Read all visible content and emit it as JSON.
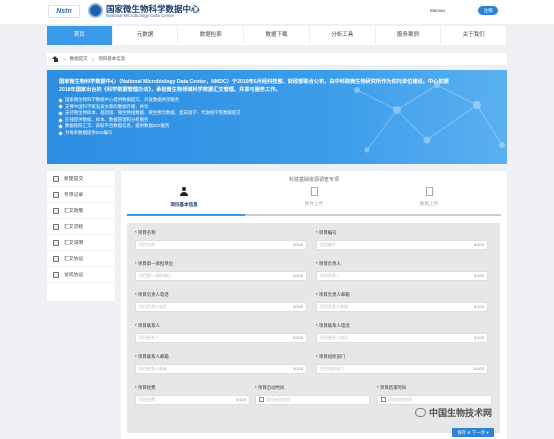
{
  "header": {
    "logo_text": "Nstn",
    "site_title": "国家微生物科学数据中心",
    "site_subtitle": "National Microbiology Data Center",
    "username": "Mamao",
    "logout_label": "注销"
  },
  "nav": {
    "items": [
      {
        "label": "首页",
        "active": true
      },
      {
        "label": "元数据",
        "active": false
      },
      {
        "label": "数据检索",
        "active": false
      },
      {
        "label": "数据下载",
        "active": false
      },
      {
        "label": "分析工具",
        "active": false
      },
      {
        "label": "服务案例",
        "active": false
      },
      {
        "label": "关于我们",
        "active": false
      }
    ]
  },
  "breadcrumb": [
    "数据提交",
    "项目基本信息"
  ],
  "banner": {
    "paragraph": "国家微生物科学数据中心（National Microbiology Data Center，NMDC）于2019年6月经科技部、财政部联合公布，由中科院微生物研究所作为依托单位建设。中心依据2018年国家出台的《科学数据管理办法》，承担微生物领域科学数据汇交管理、共享与服务工作。",
    "items": [
      "国家微生物科学数据中心提供数据提交、开放数据共享服务",
      "支撑中国科学家发表文章的数据存储、共享",
      "支持微生物样本、基因组、微生物组数据、微生物元数据、蛋白组学、代谢组学等数据提交",
      "在线提供数据、样本、数据管理和分析服务",
      "数据按照汇交、获取平台数据信息、提供数据DOI服务",
      "为每条数据提供DOI编号"
    ]
  },
  "sidebar": {
    "items": [
      "新建提交",
      "专项记录",
      "汇交政策",
      "汇交流程",
      "汇交说明",
      "汇交协议",
      "访问协议"
    ]
  },
  "main": {
    "title": "科技基础资源调查专项",
    "steps": [
      "项目基本信息",
      "附件上传",
      "数据上传"
    ],
    "active_step": 0,
    "fields": [
      {
        "label": "项目名称",
        "placeholder": "项目名称",
        "count": "0/100"
      },
      {
        "label": "项目编号",
        "placeholder": "项目编号",
        "count": "0/100"
      },
      {
        "label": "项目第一承担单位",
        "placeholder": "项目第一承担单位",
        "count": "0/100"
      },
      {
        "label": "项目负责人",
        "placeholder": "项目负责人",
        "count": "0/100"
      },
      {
        "label": "项目负责人电话",
        "placeholder": "项目负责人电话",
        "count": "0/100"
      },
      {
        "label": "项目负责人邮箱",
        "placeholder": "项目负责人邮箱",
        "count": "0/100"
      },
      {
        "label": "项目联系人",
        "placeholder": "项目联系人",
        "count": "0/100"
      },
      {
        "label": "项目联系人电话",
        "placeholder": "项目联系人电话",
        "count": "0/100"
      },
      {
        "label": "项目联系人邮箱",
        "placeholder": "项目联系人邮箱",
        "count": "0/100"
      },
      {
        "label": "项目组织部门",
        "placeholder": "项目组织部门",
        "count": "0/100"
      },
      {
        "label": "项目经费",
        "placeholder": "项目经费",
        "count": "0/100"
      },
      {
        "label": "项目启动时间",
        "placeholder": "项目启动时间",
        "count": ""
      },
      {
        "label": "项目结束时间",
        "placeholder": "项目结束时间",
        "count": ""
      }
    ],
    "save_label": "保存 & 下一步 ▾"
  },
  "watermark": "中国生物技术网"
}
